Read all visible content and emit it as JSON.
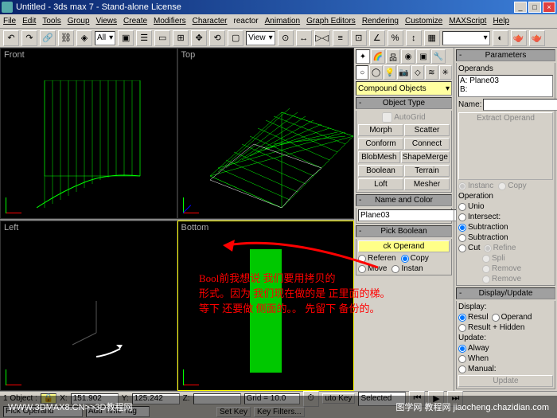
{
  "title": "Untitled - 3ds max 7 - Stand-alone License",
  "menu": [
    "File",
    "Edit",
    "Tools",
    "Group",
    "Views",
    "Create",
    "Modifiers",
    "Character",
    "reactor",
    "Animation",
    "Graph Editors",
    "Rendering",
    "Customize",
    "MAXScript",
    "Help"
  ],
  "toolbar": {
    "all": "All",
    "view": "View"
  },
  "viewports": {
    "front": "Front",
    "top": "Top",
    "left": "Left",
    "bottom": "Bottom"
  },
  "category": "Compound Objects",
  "objecttype": {
    "head": "Object Type",
    "autogrid": "AutoGrid",
    "buttons": [
      [
        "Morph",
        "Scatter"
      ],
      [
        "Conform",
        "Connect"
      ],
      [
        "BlobMesh",
        "ShapeMerge"
      ],
      [
        "Boolean",
        "Terrain"
      ],
      [
        "Loft",
        "Mesher"
      ]
    ]
  },
  "namecolor": {
    "head": "Name and Color",
    "name": "Plane03"
  },
  "pickbool": {
    "head": "Pick Boolean",
    "pick": "ck Operand",
    "ref": "Referen",
    "copy": "Copy",
    "move": "Move",
    "instan": "Instan"
  },
  "params": {
    "head": "Parameters",
    "operands": "Operands",
    "opA": "A: Plane03",
    "opB": "B:",
    "name": "Name:",
    "extract": "Extract Operand",
    "instanc": "Instanc",
    "copy": "Copy",
    "operation": "Operation",
    "unio": "Unio",
    "intersect": "Intersect:",
    "subtraction": "Subtraction",
    "cut": "Cut",
    "refine": "Refine",
    "spli": "Spli",
    "remove": "Remove"
  },
  "display": {
    "head": "Display/Update",
    "disp": "Display:",
    "resul": "Resul",
    "operand": "Operand",
    "resulthidden": "Result + Hidden",
    "update": "Update:",
    "alway": "Alway",
    "when": "When",
    "manual": "Manual:",
    "updatebtn": "Update"
  },
  "status": {
    "objects": "1 Object :",
    "lock": "🔒",
    "x": "X:",
    "xv": "151.902",
    "y": "Y:",
    "yv": "125.242",
    "z": "Z:",
    "zv": "",
    "grid": "Grid = 10.0",
    "autokey": "uto Key",
    "selected": "Selected",
    "pick": "Pick Operand",
    "addtag": "Add Time Tag",
    "setkey": "Set Key",
    "keyfilters": "Key Filters..."
  },
  "annotation": {
    "line1": "Bool前我想说   我们要用拷贝的",
    "line2": "形式。因为 我们现在做的是  正里面的梯。",
    "line3": "等下 还要做 侧面的。。 先留下 备份的。"
  },
  "watermark": {
    "left": "WWW.3DMAX8.CN>>3D教程网",
    "right": "图学网 教程网 jiaocheng.chazidian.com"
  }
}
